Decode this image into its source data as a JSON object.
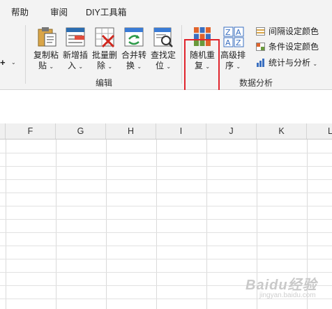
{
  "menu_tabs": [
    "帮助",
    "审阅",
    "DIY工具箱"
  ],
  "ribbon": {
    "left_cut_symbol": "+",
    "edit_group": {
      "label": "编辑",
      "buttons": [
        {
          "line1": "复制粘",
          "line2": "贴",
          "icon": "paste-icon"
        },
        {
          "line1": "新增插",
          "line2": "入",
          "icon": "insert-rows-icon"
        },
        {
          "line1": "批量删",
          "line2": "除",
          "icon": "batch-delete-icon"
        },
        {
          "line1": "合并转",
          "line2": "换",
          "icon": "merge-convert-icon"
        },
        {
          "line1": "查找定",
          "line2": "位",
          "icon": "find-locate-icon"
        }
      ]
    },
    "analysis_group": {
      "label": "数据分析",
      "random_button": {
        "line1": "随机重",
        "line2": "复",
        "icon": "random-repeat-icon"
      },
      "sort_button": {
        "line1": "高级排",
        "line2": "序",
        "icon": "advanced-sort-icon"
      },
      "small_buttons": [
        {
          "label": "间隔设定颜色",
          "icon": "interval-color-icon"
        },
        {
          "label": "条件设定颜色",
          "icon": "condition-color-icon"
        },
        {
          "label": "统计与分析",
          "icon": "statistics-icon"
        }
      ]
    },
    "highlight_color": "#e0242c"
  },
  "sheet": {
    "columns": [
      "F",
      "G",
      "H",
      "I",
      "J",
      "K",
      "L"
    ]
  },
  "watermark": {
    "text": "Baidu经验",
    "sub": "jingyan.baidu.com"
  }
}
